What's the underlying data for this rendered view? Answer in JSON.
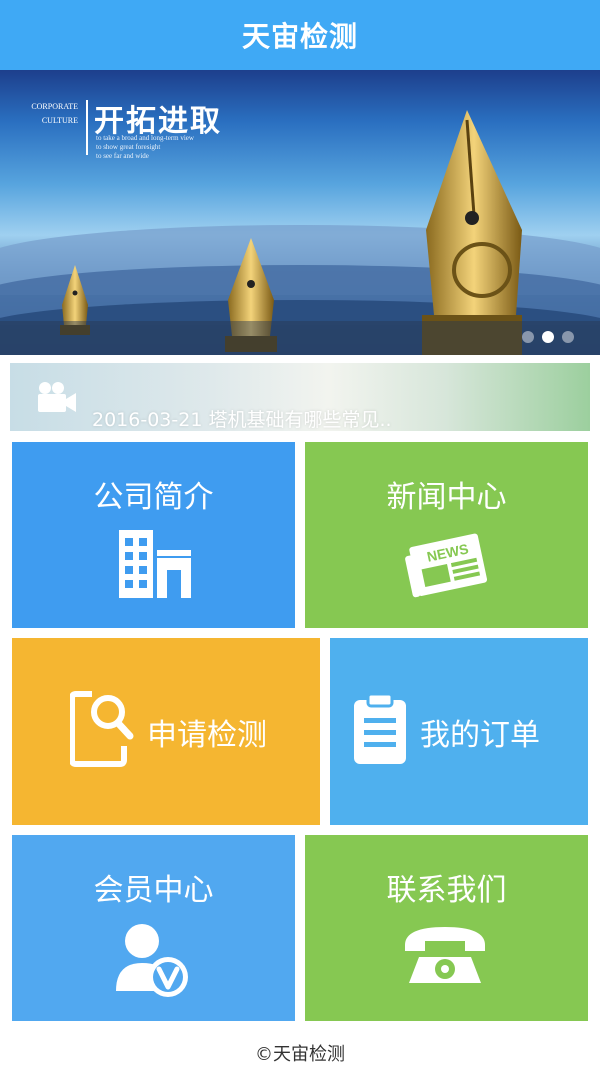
{
  "header": {
    "title": "天宙检测"
  },
  "banner": {
    "corporate_line1": "CORPORATE",
    "corporate_line2": "CULTURE",
    "slogan": "开拓进取",
    "slogan_sub1": "to take a broad and long-term view",
    "slogan_sub2": "to show great foresight",
    "slogan_sub3": "to see far and wide",
    "slides": 3,
    "active_slide": 2
  },
  "news": {
    "text": "2016-03-21 塔机基础有哪些常见.."
  },
  "tiles": [
    {
      "label": "公司简介",
      "icon": "building-icon",
      "color": "#3f9cf0"
    },
    {
      "label": "新闻中心",
      "icon": "newspaper-icon",
      "color": "#86c852"
    },
    {
      "label": "申请检测",
      "icon": "document-search-icon",
      "color": "#f5b631"
    },
    {
      "label": "我的订单",
      "icon": "clipboard-icon",
      "color": "#4fb0ee"
    },
    {
      "label": "会员中心",
      "icon": "member-verified-icon",
      "color": "#51a8f0"
    },
    {
      "label": "联系我们",
      "icon": "telephone-icon",
      "color": "#86c852"
    }
  ],
  "footer": {
    "text": "©天宙检测"
  }
}
